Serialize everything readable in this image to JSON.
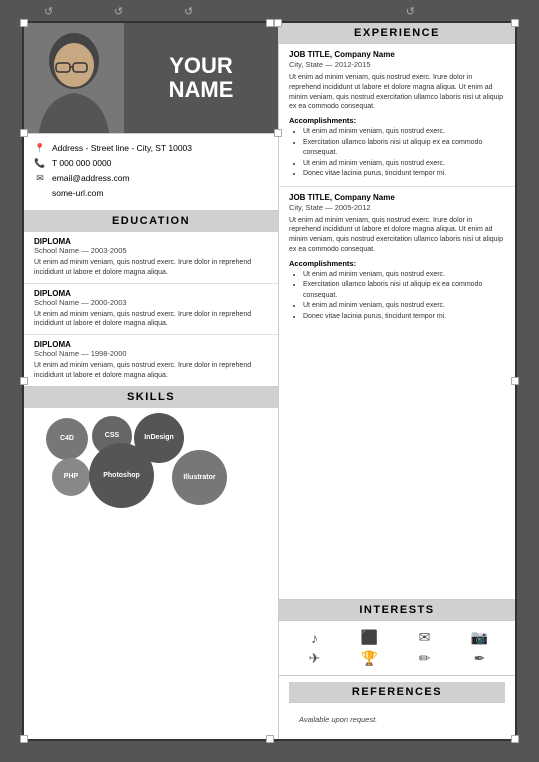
{
  "header": {
    "your_label": "YOUR",
    "name_label": "NAME"
  },
  "contact": {
    "address": "Address - Street line - City, ST 10003",
    "phone": "T 000 000 0000",
    "email": "email@address.com",
    "url": "some-url.com"
  },
  "sections": {
    "education_title": "EDUCATION",
    "skills_title": "SKILLS",
    "experience_title": "EXPERIENCE",
    "interests_title": "INTERESTS",
    "references_title": "REFERENCES"
  },
  "education": [
    {
      "degree": "DIPLOMA",
      "school": "School Name — 2003-2005",
      "body": "Ut enim ad minim veniam, quis nostrud exerc. Irure dolor in reprehend incididunt ut labore et dolore magna aliqua."
    },
    {
      "degree": "DIPLOMA",
      "school": "School Name — 2000-2003",
      "body": "Ut enim ad minim veniam, quis nostrud exerc. Irure dolor in reprehend incididunt ut labore et dolore magna aliqua."
    },
    {
      "degree": "DIPLOMA",
      "school": "School Name — 1998-2000",
      "body": "Ut enim ad minim veniam, quis nostrud exerc. Irure dolor in reprehend incididunt ut labore et dolore magna aliqua."
    }
  ],
  "skills": [
    "C4D",
    "CSS",
    "InDesign",
    "PHP",
    "Photoshop",
    "Illustrator"
  ],
  "experience": [
    {
      "title": "JOB TITLE",
      "company": "Company Name",
      "location_date": "City, State — 2012-2015",
      "body": "Ut enim ad minim veniam, quis nostrud exerc. Irure dolor in reprehend incididunt ut labore et dolore magna aliqua. Ut enim ad minim veniam, quis nostrud exercitation ullamco laboris nisi ut aliquip ex ea commodo consequat.",
      "accomplishments_title": "Accomplishments:",
      "bullets": [
        "Ut enim ad minim veniam, quis nostrud exerc.",
        "Exercitation ullamco laboris nisi ut aliquip ex ea commodo consequat.",
        "Ut enim ad minim veniam, quis nostrud exerc.",
        "Donec vitae lacinia purus, tincidunt tempor mi."
      ]
    },
    {
      "title": "JOB TITLE",
      "company": "Company Name",
      "location_date": "City, State — 2005-2012",
      "body": "Ut enim ad minim veniam, quis nostrud exerc. Irure dolor in reprehend incididunt ut labore et dolore magna aliqua. Ut enim ad minim veniam, quis nostrud exercitation ullamco laboris nisi ut aliquip ex ea commodo consequat.",
      "accomplishments_title": "Accomplishments:",
      "bullets": [
        "Ut enim ad minim veniam, quis nostrud exerc.",
        "Exercitation ullamco laboris nisi ut aliquip ex ea commodo consequat.",
        "Ut enim ad minim veniam, quis nostrud exerc.",
        "Donec vitae lacinia purus, tincidunt tempor mi."
      ]
    }
  ],
  "interests_icons": [
    "♪",
    "▦",
    "✉",
    "📷",
    "✈",
    "🏆",
    "✏",
    "✒"
  ],
  "references": {
    "text": "Available upon request."
  }
}
